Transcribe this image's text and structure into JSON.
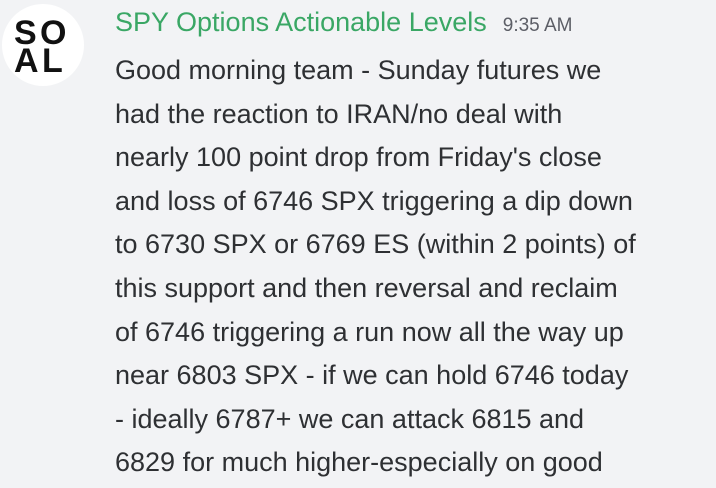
{
  "message": {
    "author": {
      "name": "SPY Options Actionable Levels",
      "name_color": "#3aa765",
      "avatar_letters": [
        "S",
        "O",
        "A",
        "L"
      ]
    },
    "timestamp": "9:35 AM",
    "lines": [
      "Good morning team - Sunday futures we",
      "had the reaction to IRAN/no deal with",
      "nearly 100 point drop from Friday's close",
      "and loss of 6746 SPX triggering a dip down",
      "to 6730 SPX or 6769 ES (within 2 points) of",
      "this support and then reversal and reclaim",
      "of 6746 triggering a run now all the way up",
      "near 6803 SPX - if we can hold 6746 today",
      "- ideally 6787+ we can attack 6815 and",
      "6829 for much higher-especially on good"
    ]
  }
}
